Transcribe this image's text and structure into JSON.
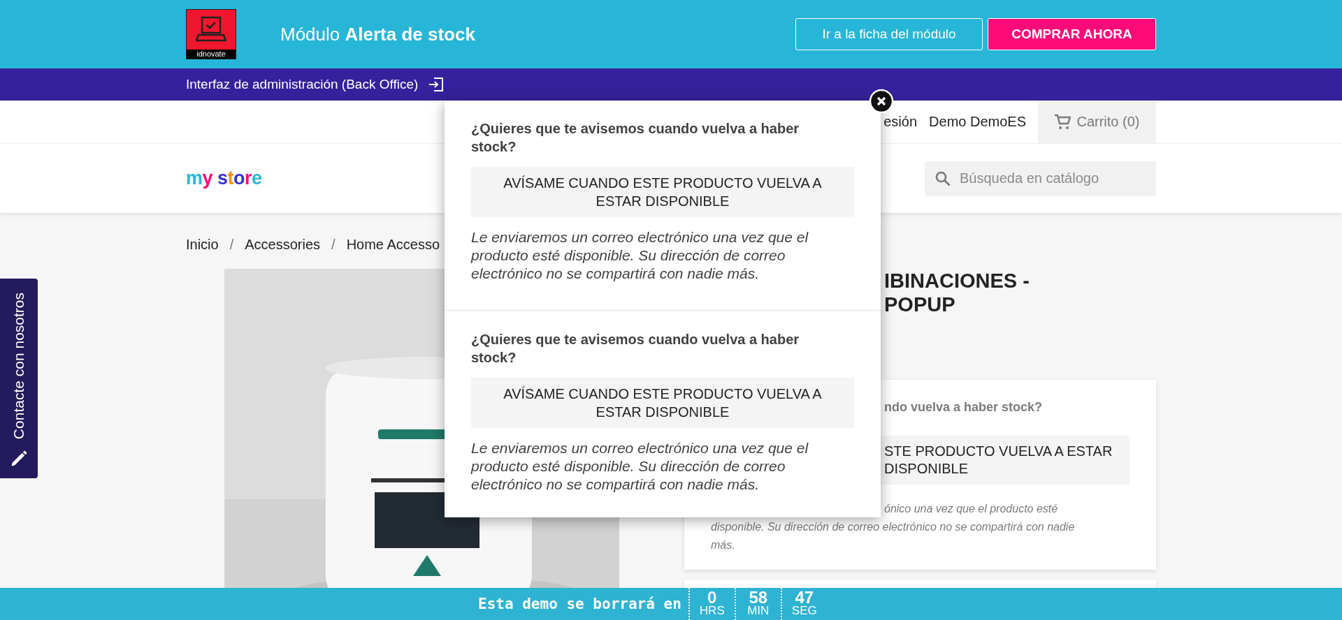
{
  "banner": {
    "logo_text": "idnovate",
    "title": "Módulo **Alerta de stock**",
    "buttons": [
      {
        "label": "Ir a la ficha del módulo",
        "kind": "outline"
      },
      {
        "label": "COMPRAR AHORA",
        "kind": "primary"
      }
    ]
  },
  "admin_bar": {
    "label": "Interfaz de administración (Back Office)"
  },
  "header": {
    "nav": [
      "esión",
      "Demo DemoES"
    ],
    "cart": "Carrito (0)",
    "logo": "my store",
    "search": {
      "placeholder": "Búsqueda en catálogo"
    }
  },
  "contact_tab": "Contacte con nosotros",
  "breadcrumb": [
    {
      "label": "Inicio"
    },
    {
      "separator": "/",
      "label": "Accessories"
    },
    {
      "separator": "/",
      "label": "Home Accesso"
    }
  ],
  "product": {
    "image": {
      "kind": "picture"
    },
    "title_lines": [
      "IBINACIONES -",
      "POPUP"
    ],
    "alert_card": {
      "question": "ndo vuelva a haber stock?",
      "button_lines": [
        "STE PRODUCTO VUELVA A ESTAR",
        "DISPONIBLE"
      ],
      "note_lines": [
        "ónico una vez que el producto esté",
        "disponible. Su dirección de correo electrónico no se compartirá con nadie",
        "más."
      ]
    }
  },
  "popup": {
    "sections": [
      {
        "question": "¿Quieres que te avisemos cuando vuelva a haber stock?",
        "button": "AVÍSAME CUANDO ESTE PRODUCTO VUELVA A ESTAR DISPONIBLE",
        "note": "Le enviaremos un correo electrónico una vez que el producto esté disponible. Su dirección de correo electrónico no se compartirá con nadie más."
      },
      {
        "question": "¿Quieres que te avisemos cuando vuelva a haber stock?",
        "button": "AVÍSAME CUANDO ESTE PRODUCTO VUELVA A ESTAR DISPONIBLE",
        "note": "Le enviaremos un correo electrónico una vez que el producto esté disponible. Su dirección de correo electrónico no se compartirá con nadie más."
      }
    ]
  },
  "countdown": {
    "label": "Esta demo se borrará en",
    "units": [
      {
        "value": "0",
        "unit": "HRS"
      },
      {
        "value": "58",
        "unit": "MIN"
      },
      {
        "value": "47",
        "unit": "SEG"
      }
    ]
  }
}
